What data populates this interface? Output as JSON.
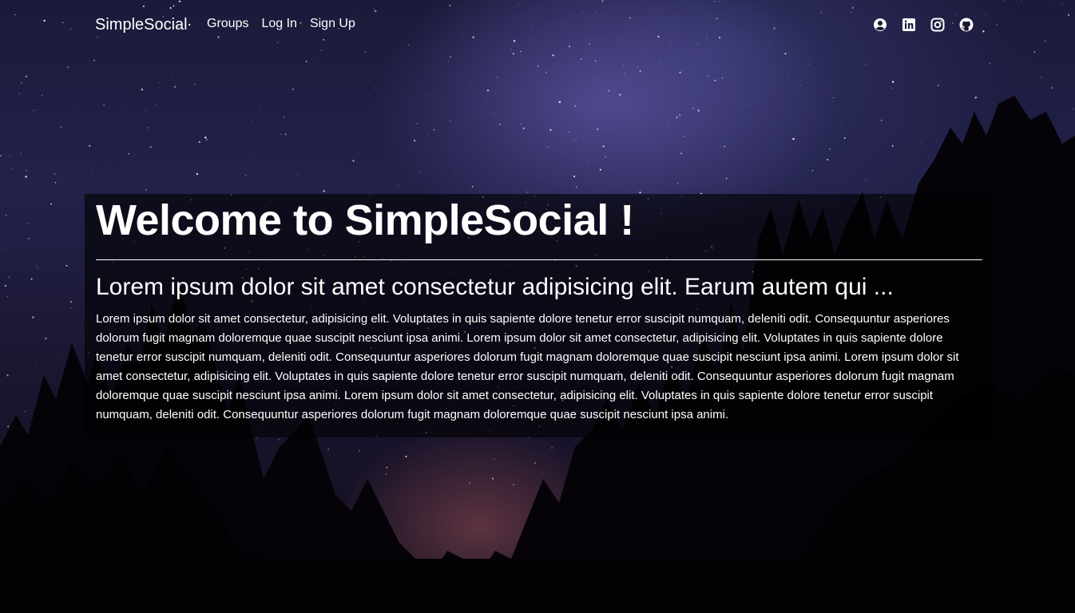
{
  "navbar": {
    "brand": "SimpleSocial",
    "links": [
      "Groups",
      "Log In",
      "Sign Up"
    ],
    "social_icons": [
      "user-circle-icon",
      "linkedin-icon",
      "instagram-icon",
      "github-icon"
    ]
  },
  "hero": {
    "title": "Welcome to SimpleSocial !",
    "subtitle": "Lorem ipsum dolor sit amet consectetur adipisicing elit. Earum autem qui ...",
    "body": "Lorem ipsum dolor sit amet consectetur, adipisicing elit. Voluptates in quis sapiente dolore tenetur error suscipit numquam, deleniti odit. Consequuntur asperiores dolorum fugit magnam doloremque quae suscipit nesciunt ipsa animi. Lorem ipsum dolor sit amet consectetur, adipisicing elit. Voluptates in quis sapiente dolore tenetur error suscipit numquam, deleniti odit. Consequuntur asperiores dolorum fugit magnam doloremque quae suscipit nesciunt ipsa animi. Lorem ipsum dolor sit amet consectetur, adipisicing elit. Voluptates in quis sapiente dolore tenetur error suscipit numquam, deleniti odit. Consequuntur asperiores dolorum fugit magnam doloremque quae suscipit nesciunt ipsa animi. Lorem ipsum dolor sit amet consectetur, adipisicing elit. Voluptates in quis sapiente dolore tenetur error suscipit numquam, deleniti odit. Consequuntur asperiores dolorum fugit magnam doloremque quae suscipit nesciunt ipsa animi."
  },
  "colors": {
    "text": "#ffffff",
    "overlay": "rgba(0,0,0,0.6)"
  }
}
